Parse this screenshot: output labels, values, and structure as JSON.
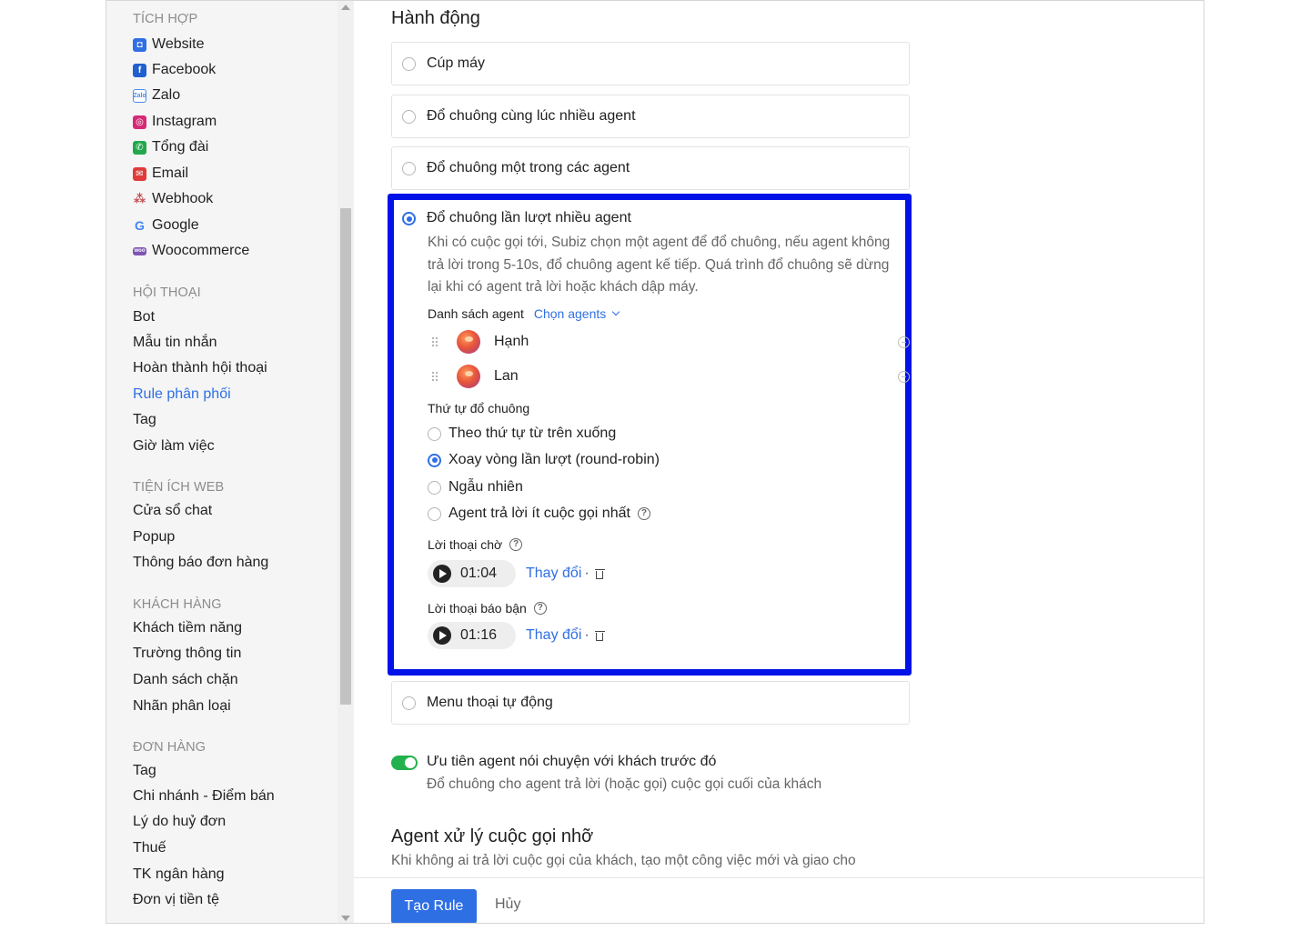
{
  "sidebar": {
    "sections": [
      {
        "title": "TÍCH HỢP",
        "items": [
          {
            "label": "Website",
            "icon": "website-icon",
            "color": "#2f6fe4"
          },
          {
            "label": "Facebook",
            "icon": "facebook-icon",
            "color": "#1f5fcf"
          },
          {
            "label": "Zalo",
            "icon": "zalo-icon",
            "color": "#4a8ef0"
          },
          {
            "label": "Instagram",
            "icon": "instagram-icon",
            "color": "#d62976"
          },
          {
            "label": "Tổng đài",
            "icon": "phone-icon",
            "color": "#22a84a"
          },
          {
            "label": "Email",
            "icon": "email-icon",
            "color": "#e03a3a"
          },
          {
            "label": "Webhook",
            "icon": "webhook-icon",
            "color": "#c24a4a"
          },
          {
            "label": "Google",
            "icon": "google-icon",
            "color": "#4285f4"
          },
          {
            "label": "Woocommerce",
            "icon": "woocommerce-icon",
            "color": "#7f54b3"
          }
        ]
      },
      {
        "title": "HỘI THOẠI",
        "items": [
          {
            "label": "Bot"
          },
          {
            "label": "Mẫu tin nhắn"
          },
          {
            "label": "Hoàn thành hội thoại"
          },
          {
            "label": "Rule phân phối",
            "active": true
          },
          {
            "label": "Tag"
          },
          {
            "label": "Giờ làm việc"
          }
        ]
      },
      {
        "title": "TIỆN ÍCH WEB",
        "items": [
          {
            "label": "Cửa sổ chat"
          },
          {
            "label": "Popup"
          },
          {
            "label": "Thông báo đơn hàng"
          }
        ]
      },
      {
        "title": "KHÁCH HÀNG",
        "items": [
          {
            "label": "Khách tiềm năng"
          },
          {
            "label": "Trường thông tin"
          },
          {
            "label": "Danh sách chặn"
          },
          {
            "label": "Nhãn phân loại"
          }
        ]
      },
      {
        "title": "ĐƠN HÀNG",
        "items": [
          {
            "label": "Tag"
          },
          {
            "label": "Chi nhánh - Điểm bán"
          },
          {
            "label": "Lý do huỷ đơn"
          },
          {
            "label": "Thuế"
          },
          {
            "label": "TK ngân hàng"
          },
          {
            "label": "Đơn vị tiền tệ"
          }
        ]
      }
    ]
  },
  "main": {
    "title": "Hành động",
    "options": [
      {
        "label": "Cúp máy",
        "selected": false
      },
      {
        "label": "Đổ chuông cùng lúc nhiều agent",
        "selected": false
      },
      {
        "label": "Đổ chuông một trong các agent",
        "selected": false
      },
      {
        "label": "Đổ chuông lần lượt nhiều agent",
        "selected": true
      },
      {
        "label": "Menu thoại tự động",
        "selected": false
      }
    ],
    "selected_detail": {
      "description": "Khi có cuộc gọi tới, Subiz chọn một agent để đổ chuông, nếu agent không trả lời trong 5-10s, đổ chuông agent kế tiếp. Quá trình đổ chuông sẽ dừng lại khi có agent trả lời hoặc khách dập máy.",
      "agent_list_label": "Danh sách agent",
      "choose_agents_label": "Chọn agents",
      "agents": [
        {
          "name": "Hạnh"
        },
        {
          "name": "Lan"
        }
      ],
      "ring_order_label": "Thứ tự đổ chuông",
      "ring_orders": [
        {
          "label": "Theo thứ tự từ trên xuống",
          "selected": false
        },
        {
          "label": "Xoay vòng lần lượt (round-robin)",
          "selected": true
        },
        {
          "label": "Ngẫu nhiên",
          "selected": false
        },
        {
          "label": "Agent trả lời ít cuộc gọi nhất",
          "selected": false,
          "help": "?"
        }
      ],
      "waiting_audio": {
        "label": "Lời thoại chờ",
        "help": "?",
        "duration": "01:04",
        "change_label": "Thay đổi",
        "sep": "·"
      },
      "busy_audio": {
        "label": "Lời thoại báo bận",
        "help": "?",
        "duration": "01:16",
        "change_label": "Thay đổi",
        "sep": "·"
      }
    },
    "priority": {
      "enabled": true,
      "title": "Ưu tiên agent nói chuyện với khách trước đó",
      "description": "Đổ chuông cho agent trả lời (hoặc gọi) cuộc gọi cuối của khách"
    },
    "missed_section": {
      "title": "Agent xử lý cuộc gọi nhỡ",
      "description": "Khi không ai trả lời cuộc gọi của khách, tạo một công việc mới và giao cho"
    }
  },
  "footer": {
    "create_label": "Tạo Rule",
    "cancel_label": "Hủy"
  },
  "colors": {
    "accent": "#2f6fe4",
    "highlight_border": "#0012e8",
    "toggle_on": "#22b14c"
  }
}
